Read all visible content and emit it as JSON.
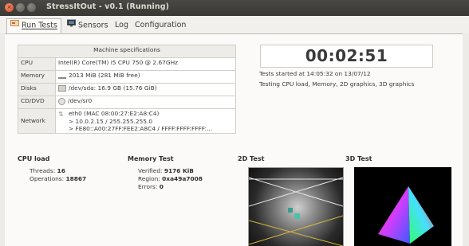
{
  "window": {
    "title": "StressItOut - v0.1 (Running)",
    "close_glyph": "×"
  },
  "tabs": [
    {
      "label": "Run Tests",
      "icon": "run-tests-icon",
      "active": true
    },
    {
      "label": "Sensors",
      "icon": "monitor-icon",
      "active": false
    },
    {
      "label": "Log",
      "active": false
    },
    {
      "label": "Configuration",
      "active": false
    }
  ],
  "machine_specs": {
    "header": "Machine specifications",
    "rows": [
      {
        "label": "CPU",
        "value": "Intel(R) Core(TM) i5 CPU 750 @ 2.67GHz"
      },
      {
        "label": "Memory",
        "icon": "memory-icon",
        "value": "2013 MiB (281 MiB free)"
      },
      {
        "label": "Disks",
        "icon": "disk-icon",
        "value": "/dev/sda: 16.9 GB (15.76 GiB)"
      },
      {
        "label": "CD/DVD",
        "icon": "cd-icon",
        "value": "/dev/sr0"
      },
      {
        "label": "Network",
        "icon": "network-icon",
        "lines": [
          "eth0  (MAC 08:00:27:E2:A8:C4)",
          "> 10.0.2.15 / 255.255.255.0",
          "> FE80::A00:27FF:FEE2:A8C4 / FFFF:FFFF:FFFF:..."
        ]
      }
    ]
  },
  "timer": {
    "elapsed": "00:02:51",
    "started": "Tests started at 14:05:32 on 13/07/12",
    "testing": "Testing CPU load, Memory, 2D graphics, 3D graphics"
  },
  "cpu_load": {
    "heading": "CPU load",
    "threads_label": "Threads:",
    "threads": "16",
    "operations_label": "Operations:",
    "operations": "18867"
  },
  "memory_test": {
    "heading": "Memory Test",
    "verified_label": "Verified:",
    "verified": "9176 KiB",
    "region_label": "Region:",
    "region": "0xa49a7008",
    "errors_label": "Errors:",
    "errors": "0"
  },
  "test2d": {
    "heading": "2D Test"
  },
  "test3d": {
    "heading": "3D Test"
  },
  "colors": {
    "titlebar": "#3e3c38",
    "close_button": "#e05a2b",
    "tab_active": "#fbfaf8"
  }
}
